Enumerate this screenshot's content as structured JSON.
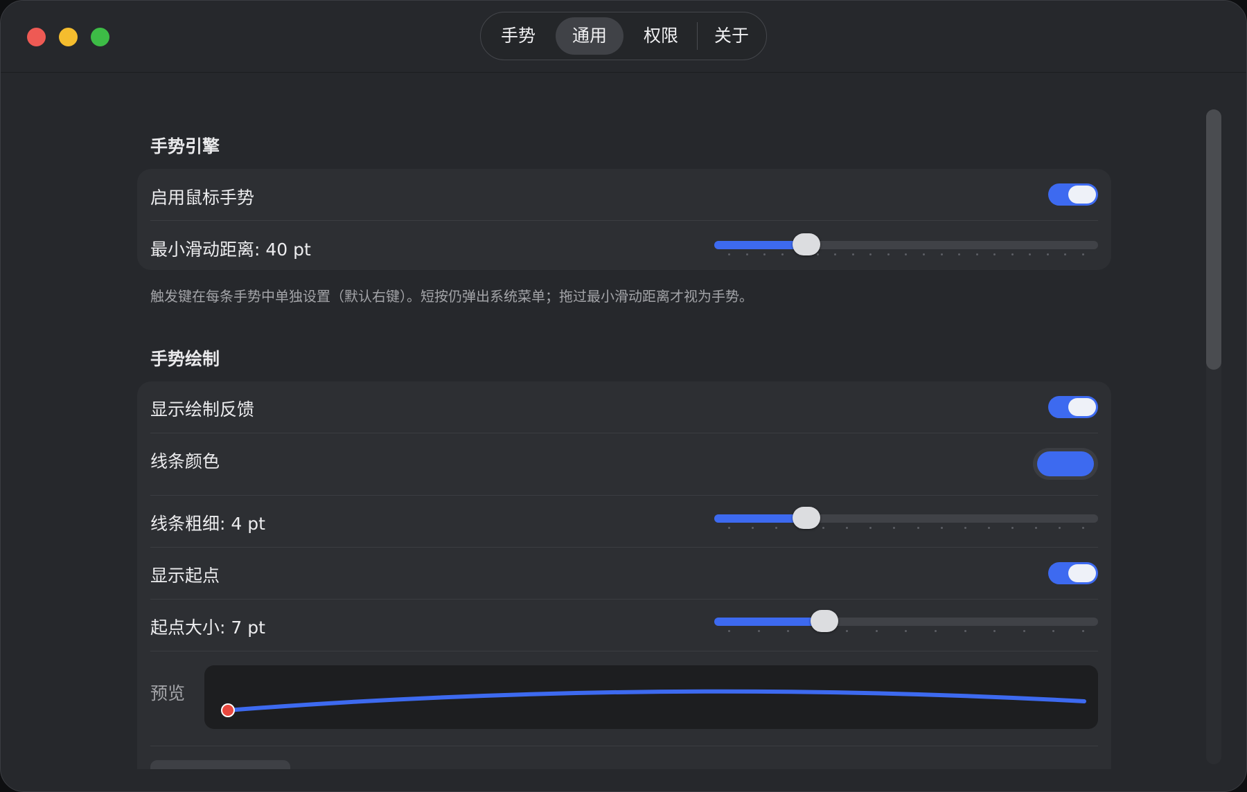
{
  "tabs": [
    {
      "label": "手势",
      "active": false
    },
    {
      "label": "通用",
      "active": true
    },
    {
      "label": "权限",
      "active": false
    },
    {
      "label": "关于",
      "active": false
    }
  ],
  "gesture_engine": {
    "title": "手势引擎",
    "enable_label": "启用鼠标手势",
    "enable_on": true,
    "min_distance_label": "最小滑动距离: 40 pt",
    "min_distance_fraction": 0.22,
    "note": "触发键在每条手势中单独设置（默认右键）。短按仍弹出系统菜单；拖过最小滑动距离才视为手势。"
  },
  "gesture_drawing": {
    "title": "手势绘制",
    "show_feedback_label": "显示绘制反馈",
    "show_feedback_on": true,
    "line_color_label": "线条颜色",
    "line_color": "#3d6af0",
    "line_width_label": "线条粗细: 4 pt",
    "line_width_fraction": 0.22,
    "show_start_label": "显示起点",
    "show_start_on": true,
    "start_size_label": "起点大小: 7 pt",
    "start_size_fraction": 0.27,
    "preview_label": "预览",
    "start_point_color": "#e8473e"
  },
  "colors": {
    "accent": "#3d6af0",
    "window_bg": "#26282c",
    "card_bg": "#2d2f33"
  }
}
